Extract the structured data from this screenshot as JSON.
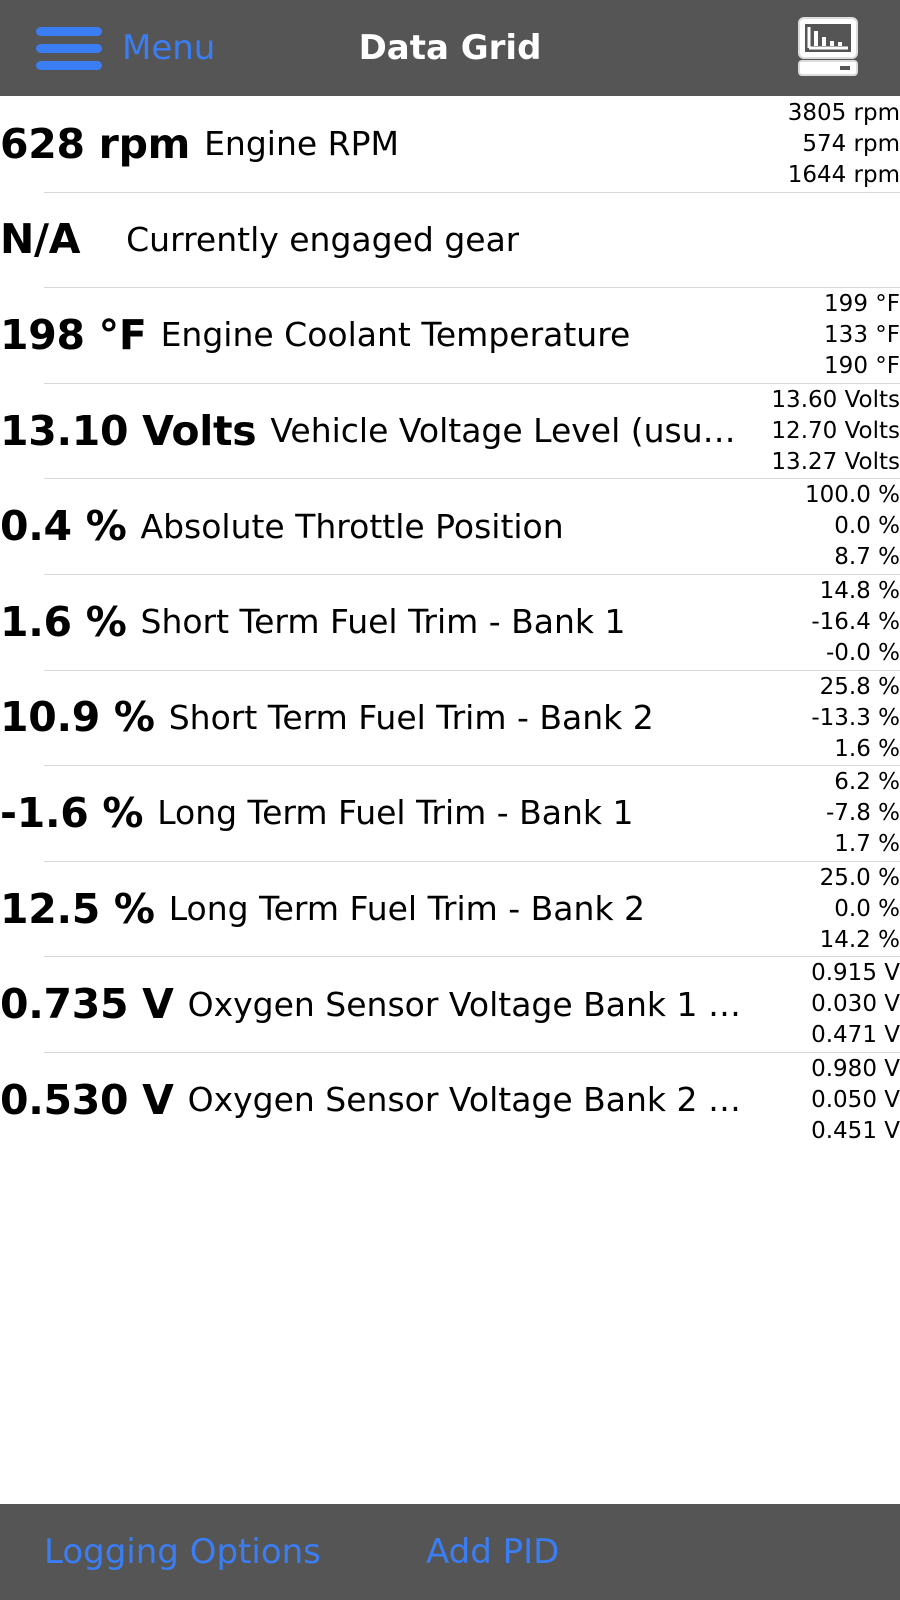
{
  "header": {
    "menu_label": "Menu",
    "title": "Data Grid",
    "dashboard_icon": "dashboard-monitor-icon"
  },
  "rows": [
    {
      "value": "628 rpm",
      "name": "Engine RPM",
      "max": "3805 rpm",
      "min": "574 rpm",
      "avg": "1644 rpm"
    },
    {
      "value": "N/A",
      "name": "Currently engaged gear",
      "max": "",
      "min": "",
      "avg": ""
    },
    {
      "value": "198 °F",
      "name": "Engine Coolant Temperature",
      "max": "199 °F",
      "min": "133 °F",
      "avg": "190 °F"
    },
    {
      "value": "13.10 Volts",
      "name": "Vehicle Voltage Level (usually…",
      "max": "13.60 Volts",
      "min": "12.70 Volts",
      "avg": "13.27 Volts"
    },
    {
      "value": "0.4 %",
      "name": "Absolute Throttle Position",
      "max": "100.0 %",
      "min": "0.0 %",
      "avg": "8.7 %"
    },
    {
      "value": "1.6 %",
      "name": "Short Term Fuel Trim - Bank 1",
      "max": "14.8 %",
      "min": "-16.4 %",
      "avg": "-0.0 %"
    },
    {
      "value": "10.9 %",
      "name": "Short Term Fuel Trim - Bank 2",
      "max": "25.8 %",
      "min": "-13.3 %",
      "avg": "1.6 %"
    },
    {
      "value": "-1.6 %",
      "name": "Long Term Fuel Trim - Bank 1",
      "max": "6.2 %",
      "min": "-7.8 %",
      "avg": "1.7 %"
    },
    {
      "value": "12.5 %",
      "name": "Long Term Fuel Trim - Bank 2",
      "max": "25.0 %",
      "min": "0.0 %",
      "avg": "14.2 %"
    },
    {
      "value": "0.735 V",
      "name": "Oxygen Sensor Voltage Bank 1 - S...",
      "max": "0.915 V",
      "min": "0.030 V",
      "avg": "0.471 V"
    },
    {
      "value": "0.530 V",
      "name": "Oxygen Sensor Voltage Bank 2 - S...",
      "max": "0.980 V",
      "min": "0.050 V",
      "avg": "0.451 V"
    }
  ],
  "footer": {
    "logging_options_label": "Logging Options",
    "add_pid_label": "Add PID"
  },
  "colors": {
    "bar_background": "#555555",
    "accent": "#3b7df2",
    "divider": "#d8d8d8"
  }
}
